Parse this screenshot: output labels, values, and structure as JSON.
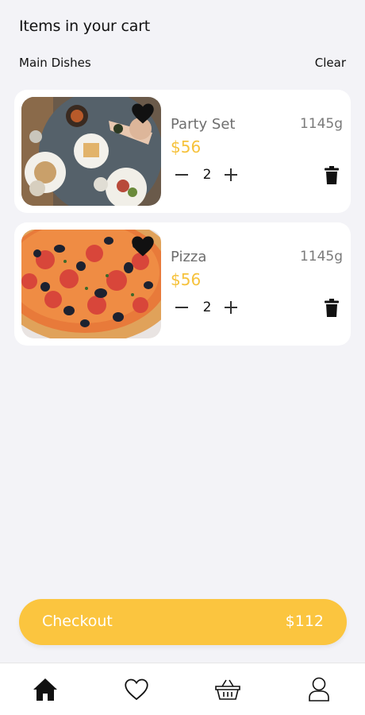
{
  "header": {
    "title": "Items in your cart",
    "category": "Main Dishes",
    "clear_label": "Clear"
  },
  "cart": {
    "items": [
      {
        "name": "Party Set",
        "weight": "1145g",
        "price": "$56",
        "quantity": "2",
        "image": "party-set-photo"
      },
      {
        "name": "Pizza",
        "weight": "1145g",
        "price": "$56",
        "quantity": "2",
        "image": "pizza-photo"
      }
    ]
  },
  "checkout": {
    "label": "Checkout",
    "total": "$112"
  },
  "nav": {
    "items": [
      {
        "icon": "home-icon",
        "active": true
      },
      {
        "icon": "heart-icon",
        "active": false
      },
      {
        "icon": "basket-icon",
        "active": false
      },
      {
        "icon": "user-icon",
        "active": false
      }
    ]
  },
  "colors": {
    "accent": "#fbc53f",
    "price": "#f6c23c",
    "background": "#f3f3f7"
  }
}
